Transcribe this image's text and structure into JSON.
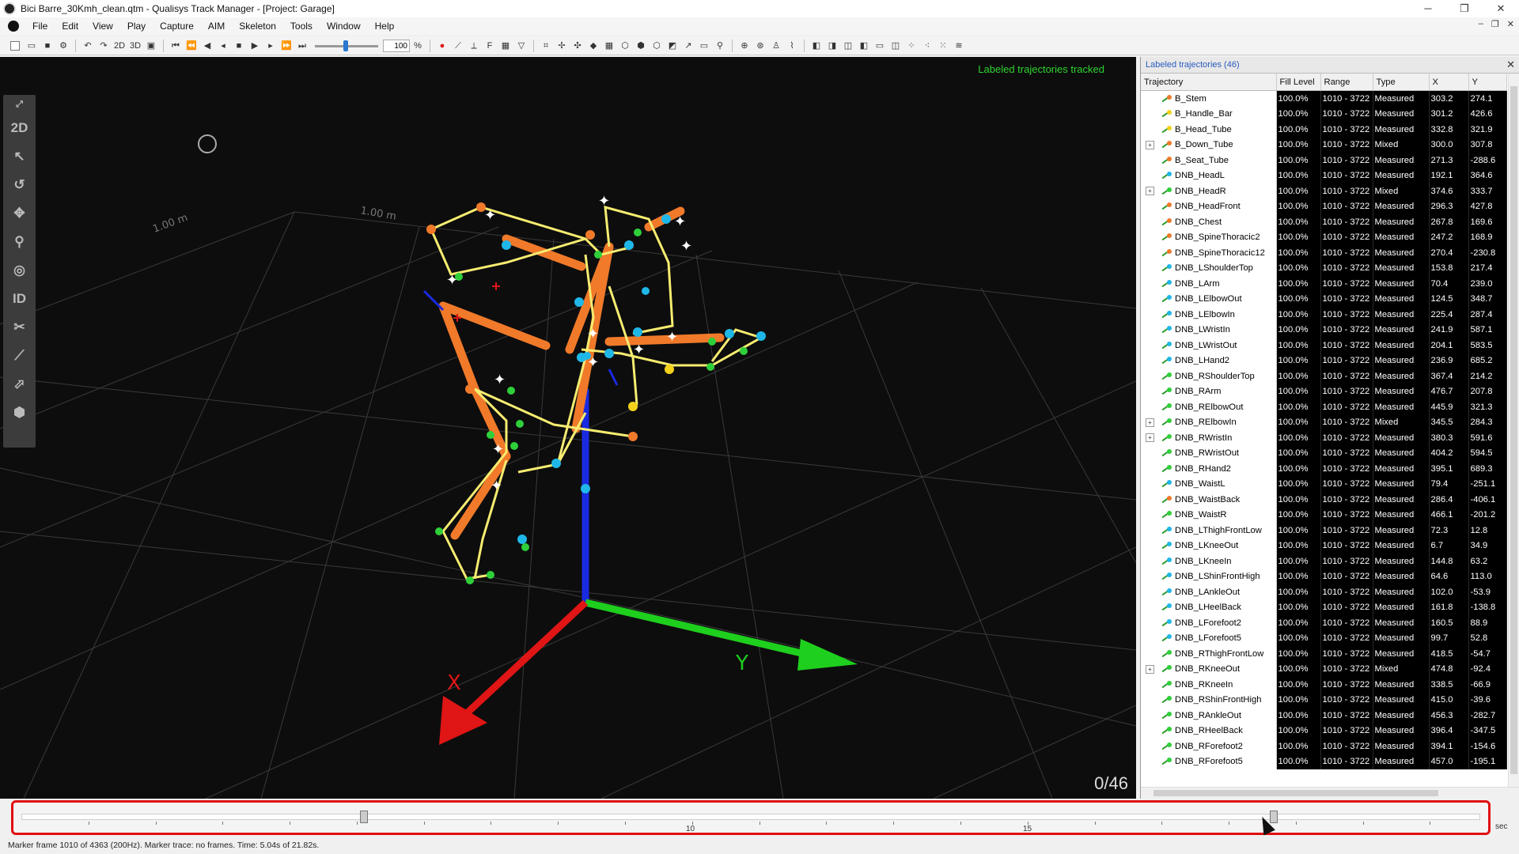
{
  "window": {
    "title": "Bici Barre_30Kmh_clean.qtm - Qualisys Track Manager - [Project: Garage]",
    "minimize": "─",
    "maximize": "❐",
    "close": "✕"
  },
  "menu": [
    "File",
    "Edit",
    "View",
    "Play",
    "Capture",
    "AIM",
    "Skeleton",
    "Tools",
    "Window",
    "Help"
  ],
  "toolbar": {
    "btn_2d": "2D",
    "btn_3d": "3D",
    "speed_value": "100",
    "speed_unit": "%"
  },
  "lefttools": {
    "tool_2d": "2D",
    "tool_id": "ID"
  },
  "view": {
    "status_text": "Labeled trajectories tracked",
    "counter": "0/46",
    "grid_label_1": "1.00 m",
    "grid_label_2": "1.00 m",
    "axes_colors": {
      "x": "#e01515",
      "y": "#1ecf1e",
      "z": "#1a2ae0"
    }
  },
  "panel": {
    "title": "Labeled trajectories (46)",
    "columns": [
      "Trajectory",
      "Fill Level",
      "Range",
      "Type",
      "X",
      "Y"
    ],
    "rows": [
      {
        "name": "B_Stem",
        "fill": "100.0%",
        "range": "1010 - 3722",
        "type": "Measured",
        "x": "303.2",
        "y": "274.1",
        "exp": false,
        "color": "#f07a2a"
      },
      {
        "name": "B_Handle_Bar",
        "fill": "100.0%",
        "range": "1010 - 3722",
        "type": "Measured",
        "x": "301.2",
        "y": "426.6",
        "exp": false,
        "color": "#f2d21a"
      },
      {
        "name": "B_Head_Tube",
        "fill": "100.0%",
        "range": "1010 - 3722",
        "type": "Measured",
        "x": "332.8",
        "y": "321.9",
        "exp": false,
        "color": "#f2d21a"
      },
      {
        "name": "B_Down_Tube",
        "fill": "100.0%",
        "range": "1010 - 3722",
        "type": "Mixed",
        "x": "300.0",
        "y": "307.8",
        "exp": true,
        "color": "#f07a2a"
      },
      {
        "name": "B_Seat_Tube",
        "fill": "100.0%",
        "range": "1010 - 3722",
        "type": "Measured",
        "x": "271.3",
        "y": "-288.6",
        "exp": false,
        "color": "#f07a2a"
      },
      {
        "name": "DNB_HeadL",
        "fill": "100.0%",
        "range": "1010 - 3722",
        "type": "Measured",
        "x": "192.1",
        "y": "364.6",
        "exp": false,
        "color": "#1fb7e8"
      },
      {
        "name": "DNB_HeadR",
        "fill": "100.0%",
        "range": "1010 - 3722",
        "type": "Mixed",
        "x": "374.6",
        "y": "333.7",
        "exp": true,
        "color": "#2fcf3a"
      },
      {
        "name": "DNB_HeadFront",
        "fill": "100.0%",
        "range": "1010 - 3722",
        "type": "Measured",
        "x": "296.3",
        "y": "427.8",
        "exp": false,
        "color": "#f07a2a"
      },
      {
        "name": "DNB_Chest",
        "fill": "100.0%",
        "range": "1010 - 3722",
        "type": "Measured",
        "x": "267.8",
        "y": "169.6",
        "exp": false,
        "color": "#f07a2a"
      },
      {
        "name": "DNB_SpineThoracic2",
        "fill": "100.0%",
        "range": "1010 - 3722",
        "type": "Measured",
        "x": "247.2",
        "y": "168.9",
        "exp": false,
        "color": "#f07a2a"
      },
      {
        "name": "DNB_SpineThoracic12",
        "fill": "100.0%",
        "range": "1010 - 3722",
        "type": "Measured",
        "x": "270.4",
        "y": "-230.8",
        "exp": false,
        "color": "#f07a2a"
      },
      {
        "name": "DNB_LShoulderTop",
        "fill": "100.0%",
        "range": "1010 - 3722",
        "type": "Measured",
        "x": "153.8",
        "y": "217.4",
        "exp": false,
        "color": "#1fb7e8"
      },
      {
        "name": "DNB_LArm",
        "fill": "100.0%",
        "range": "1010 - 3722",
        "type": "Measured",
        "x": "70.4",
        "y": "239.0",
        "exp": false,
        "color": "#1fb7e8"
      },
      {
        "name": "DNB_LElbowOut",
        "fill": "100.0%",
        "range": "1010 - 3722",
        "type": "Measured",
        "x": "124.5",
        "y": "348.7",
        "exp": false,
        "color": "#1fb7e8"
      },
      {
        "name": "DNB_LElbowIn",
        "fill": "100.0%",
        "range": "1010 - 3722",
        "type": "Measured",
        "x": "225.4",
        "y": "287.4",
        "exp": false,
        "color": "#1fb7e8"
      },
      {
        "name": "DNB_LWristIn",
        "fill": "100.0%",
        "range": "1010 - 3722",
        "type": "Measured",
        "x": "241.9",
        "y": "587.1",
        "exp": false,
        "color": "#1fb7e8"
      },
      {
        "name": "DNB_LWristOut",
        "fill": "100.0%",
        "range": "1010 - 3722",
        "type": "Measured",
        "x": "204.1",
        "y": "583.5",
        "exp": false,
        "color": "#1fb7e8"
      },
      {
        "name": "DNB_LHand2",
        "fill": "100.0%",
        "range": "1010 - 3722",
        "type": "Measured",
        "x": "236.9",
        "y": "685.2",
        "exp": false,
        "color": "#1fb7e8"
      },
      {
        "name": "DNB_RShoulderTop",
        "fill": "100.0%",
        "range": "1010 - 3722",
        "type": "Measured",
        "x": "367.4",
        "y": "214.2",
        "exp": false,
        "color": "#2fcf3a"
      },
      {
        "name": "DNB_RArm",
        "fill": "100.0%",
        "range": "1010 - 3722",
        "type": "Measured",
        "x": "476.7",
        "y": "207.8",
        "exp": false,
        "color": "#2fcf3a"
      },
      {
        "name": "DNB_RElbowOut",
        "fill": "100.0%",
        "range": "1010 - 3722",
        "type": "Measured",
        "x": "445.9",
        "y": "321.3",
        "exp": false,
        "color": "#2fcf3a"
      },
      {
        "name": "DNB_RElbowIn",
        "fill": "100.0%",
        "range": "1010 - 3722",
        "type": "Mixed",
        "x": "345.5",
        "y": "284.3",
        "exp": true,
        "color": "#2fcf3a"
      },
      {
        "name": "DNB_RWristIn",
        "fill": "100.0%",
        "range": "1010 - 3722",
        "type": "Measured",
        "x": "380.3",
        "y": "591.6",
        "exp": true,
        "color": "#2fcf3a"
      },
      {
        "name": "DNB_RWristOut",
        "fill": "100.0%",
        "range": "1010 - 3722",
        "type": "Measured",
        "x": "404.2",
        "y": "594.5",
        "exp": false,
        "color": "#2fcf3a"
      },
      {
        "name": "DNB_RHand2",
        "fill": "100.0%",
        "range": "1010 - 3722",
        "type": "Measured",
        "x": "395.1",
        "y": "689.3",
        "exp": false,
        "color": "#2fcf3a"
      },
      {
        "name": "DNB_WaistL",
        "fill": "100.0%",
        "range": "1010 - 3722",
        "type": "Measured",
        "x": "79.4",
        "y": "-251.1",
        "exp": false,
        "color": "#1fb7e8"
      },
      {
        "name": "DNB_WaistBack",
        "fill": "100.0%",
        "range": "1010 - 3722",
        "type": "Measured",
        "x": "286.4",
        "y": "-406.1",
        "exp": false,
        "color": "#f07a2a"
      },
      {
        "name": "DNB_WaistR",
        "fill": "100.0%",
        "range": "1010 - 3722",
        "type": "Measured",
        "x": "466.1",
        "y": "-201.2",
        "exp": false,
        "color": "#2fcf3a"
      },
      {
        "name": "DNB_LThighFrontLow",
        "fill": "100.0%",
        "range": "1010 - 3722",
        "type": "Measured",
        "x": "72.3",
        "y": "12.8",
        "exp": false,
        "color": "#1fb7e8"
      },
      {
        "name": "DNB_LKneeOut",
        "fill": "100.0%",
        "range": "1010 - 3722",
        "type": "Measured",
        "x": "6.7",
        "y": "34.9",
        "exp": false,
        "color": "#1fb7e8"
      },
      {
        "name": "DNB_LKneeIn",
        "fill": "100.0%",
        "range": "1010 - 3722",
        "type": "Measured",
        "x": "144.8",
        "y": "63.2",
        "exp": false,
        "color": "#1fb7e8"
      },
      {
        "name": "DNB_LShinFrontHigh",
        "fill": "100.0%",
        "range": "1010 - 3722",
        "type": "Measured",
        "x": "64.6",
        "y": "113.0",
        "exp": false,
        "color": "#1fb7e8"
      },
      {
        "name": "DNB_LAnkleOut",
        "fill": "100.0%",
        "range": "1010 - 3722",
        "type": "Measured",
        "x": "102.0",
        "y": "-53.9",
        "exp": false,
        "color": "#1fb7e8"
      },
      {
        "name": "DNB_LHeelBack",
        "fill": "100.0%",
        "range": "1010 - 3722",
        "type": "Measured",
        "x": "161.8",
        "y": "-138.8",
        "exp": false,
        "color": "#1fb7e8"
      },
      {
        "name": "DNB_LForefoot2",
        "fill": "100.0%",
        "range": "1010 - 3722",
        "type": "Measured",
        "x": "160.5",
        "y": "88.9",
        "exp": false,
        "color": "#1fb7e8"
      },
      {
        "name": "DNB_LForefoot5",
        "fill": "100.0%",
        "range": "1010 - 3722",
        "type": "Measured",
        "x": "99.7",
        "y": "52.8",
        "exp": false,
        "color": "#1fb7e8"
      },
      {
        "name": "DNB_RThighFrontLow",
        "fill": "100.0%",
        "range": "1010 - 3722",
        "type": "Measured",
        "x": "418.5",
        "y": "-54.7",
        "exp": false,
        "color": "#2fcf3a"
      },
      {
        "name": "DNB_RKneeOut",
        "fill": "100.0%",
        "range": "1010 - 3722",
        "type": "Mixed",
        "x": "474.8",
        "y": "-92.4",
        "exp": true,
        "color": "#2fcf3a"
      },
      {
        "name": "DNB_RKneeIn",
        "fill": "100.0%",
        "range": "1010 - 3722",
        "type": "Measured",
        "x": "338.5",
        "y": "-66.9",
        "exp": false,
        "color": "#2fcf3a"
      },
      {
        "name": "DNB_RShinFrontHigh",
        "fill": "100.0%",
        "range": "1010 - 3722",
        "type": "Measured",
        "x": "415.0",
        "y": "-39.6",
        "exp": false,
        "color": "#2fcf3a"
      },
      {
        "name": "DNB_RAnkleOut",
        "fill": "100.0%",
        "range": "1010 - 3722",
        "type": "Measured",
        "x": "456.3",
        "y": "-282.7",
        "exp": false,
        "color": "#2fcf3a"
      },
      {
        "name": "DNB_RHeelBack",
        "fill": "100.0%",
        "range": "1010 - 3722",
        "type": "Measured",
        "x": "396.4",
        "y": "-347.5",
        "exp": false,
        "color": "#2fcf3a"
      },
      {
        "name": "DNB_RForefoot2",
        "fill": "100.0%",
        "range": "1010 - 3722",
        "type": "Measured",
        "x": "394.1",
        "y": "-154.6",
        "exp": false,
        "color": "#2fcf3a"
      },
      {
        "name": "DNB_RForefoot5",
        "fill": "100.0%",
        "range": "1010 - 3722",
        "type": "Measured",
        "x": "457.0",
        "y": "-195.1",
        "exp": false,
        "color": "#2fcf3a"
      }
    ]
  },
  "timeline": {
    "labels": [
      "10",
      "15"
    ],
    "unit": "sec",
    "start_fraction": 0.2315,
    "end_fraction": 0.853
  },
  "status": "Marker frame 1010 of 4363 (200Hz). Marker trace: no frames. Time: 5.04s of 21.82s."
}
